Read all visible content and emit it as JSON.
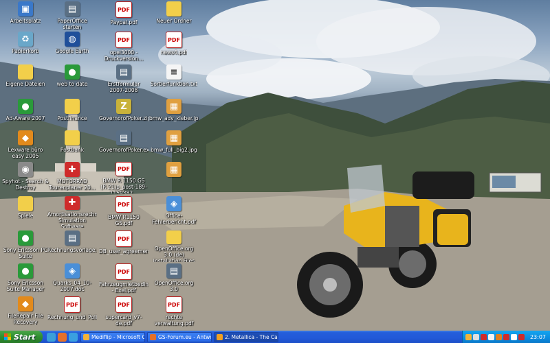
{
  "desktop": {
    "icons": [
      {
        "label": "Arbeitsplatz",
        "icon": "computer-icon",
        "type": "sys"
      },
      {
        "label": "PaperOffice starten",
        "icon": "paperoffice-icon",
        "type": "exe"
      },
      {
        "label": "Paypal.pdf",
        "icon": "pdf-icon",
        "type": "pdf"
      },
      {
        "label": "Neuer Ordner",
        "icon": "folder-icon",
        "type": "folder"
      },
      {
        "label": "Papierkorb",
        "icon": "recycle-bin-icon",
        "type": "trash"
      },
      {
        "label": "Google Earth",
        "icon": "google-earth-icon",
        "type": "globe"
      },
      {
        "label": "opel3000 - Druckversion...",
        "icon": "pdf-icon",
        "type": "pdf"
      },
      {
        "label": "news4.pdf",
        "icon": "pdf-icon",
        "type": "pdf"
      },
      {
        "label": "Eigene Dateien",
        "icon": "my-documents-icon",
        "type": "folder"
      },
      {
        "label": "web to date",
        "icon": "web-to-date-icon",
        "type": "green"
      },
      {
        "label": "Erstformular 2007-2008",
        "icon": "form-icon",
        "type": "exe"
      },
      {
        "label": "Sortierfunktion.txt",
        "icon": "text-file-icon",
        "type": "txt"
      },
      {
        "label": "Ad-Aware 2007",
        "icon": "ad-aware-icon",
        "type": "green"
      },
      {
        "label": "Postfinance",
        "icon": "folder-icon",
        "type": "folder"
      },
      {
        "label": "GovernorofPoker.zip",
        "icon": "zip-icon",
        "type": "zip"
      },
      {
        "label": "bmw_adv_kleber.jpg",
        "icon": "image-icon",
        "type": "img"
      },
      {
        "label": "Lexware büro easy 2005",
        "icon": "lexware-icon",
        "type": "orange"
      },
      {
        "label": "Postbank",
        "icon": "folder-icon",
        "type": "folder"
      },
      {
        "label": "GovernorofPoker.exe",
        "icon": "exe-icon",
        "type": "exe"
      },
      {
        "label": "bmw_full_big2.jpg",
        "icon": "image-icon",
        "type": "img"
      },
      {
        "label": "Spyhot - Search & Destroy",
        "icon": "spybot-icon",
        "type": "gray"
      },
      {
        "label": "MOTORRAD Tourenplaner 20...",
        "icon": "motorrad-icon",
        "type": "red"
      },
      {
        "label": "BMW R 1150 GS (R 21)p_post-189-1159382...",
        "icon": "pdf-icon",
        "type": "pdf"
      },
      {
        "label": "",
        "icon": "image-icon",
        "type": "img"
      },
      {
        "label": "Spiele",
        "icon": "folder-icon",
        "type": "folder"
      },
      {
        "label": "Amortisationsrechner Simulation Software",
        "icon": "amortisation-icon",
        "type": "red"
      },
      {
        "label": "BMW R1150 GS.pdf",
        "icon": "pdf-icon",
        "type": "pdf"
      },
      {
        "label": "Office-Fehlerbericht.pdf",
        "icon": "pdf-icon",
        "type": "blue2"
      },
      {
        "label": "Sony Ericsson PC Suite",
        "icon": "sony-ericsson-icon",
        "type": "green"
      },
      {
        "label": "Rechnungsvorlage.pdf",
        "icon": "rechnung-icon",
        "type": "exe"
      },
      {
        "label": "DB_user_agreement...",
        "icon": "pdf-icon",
        "type": "pdf"
      },
      {
        "label": "OpenOffice.org 3.0 (de) Installation Files",
        "icon": "folder-icon",
        "type": "folder"
      },
      {
        "label": "Sony Ericsson Suite Manager",
        "icon": "sony-ericsson-manager-icon",
        "type": "green"
      },
      {
        "label": "Quarks_04_10-2007.doc",
        "icon": "quarks-icon",
        "type": "blue2"
      },
      {
        "label": "Fahrzeugmietbedingungen - Exel.pdf",
        "icon": "pdf-icon",
        "type": "pdf"
      },
      {
        "label": "OpenOffice.org 3.0",
        "icon": "openoffice-icon",
        "type": "exe"
      },
      {
        "label": "FileRepair File Recovery",
        "icon": "file-recovery-icon",
        "type": "orange"
      },
      {
        "label": "Rechnung_und_Policy.pdf",
        "icon": "pdf-icon",
        "type": "pdf"
      },
      {
        "label": "supercard_v7-de.pdf",
        "icon": "pdf-icon",
        "type": "pdf"
      },
      {
        "label": "rechte verwaltung.pdf",
        "icon": "pdf-icon",
        "type": "pdf"
      }
    ]
  },
  "taskbar": {
    "start_label": "Start",
    "quicklaunch": [
      {
        "icon": "show-desktop-icon",
        "color": "#3a9fd8"
      },
      {
        "icon": "firefox-icon",
        "color": "#e5702a"
      },
      {
        "icon": "internet-explorer-icon",
        "color": "#3aa0e0"
      }
    ],
    "tasks": [
      {
        "label": "Mediflip - Microsoft O...",
        "icon": "outlook-icon",
        "color": "#f2b33a",
        "active": false
      },
      {
        "label": "GS-Forum.eu - Antwo...",
        "icon": "firefox-icon",
        "color": "#e5702a",
        "active": false
      },
      {
        "label": "2. Metallica - The Call...",
        "icon": "winamp-icon",
        "color": "#f0a020",
        "active": true
      }
    ],
    "tray_icons": [
      {
        "icon": "security-icon",
        "color": "#f2b33a"
      },
      {
        "icon": "network-icon",
        "color": "#e0e0e0"
      },
      {
        "icon": "antivirus-icon",
        "color": "#cf2b2b"
      },
      {
        "icon": "volume-icon",
        "color": "#f5f5f5"
      },
      {
        "icon": "warning-icon",
        "color": "#e08020"
      },
      {
        "icon": "update-icon",
        "color": "#cf2b2b"
      },
      {
        "icon": "pdf-tray-icon",
        "color": "#ffffff"
      },
      {
        "icon": "device-icon",
        "color": "#cf2b2b"
      }
    ],
    "clock": "23:07"
  }
}
